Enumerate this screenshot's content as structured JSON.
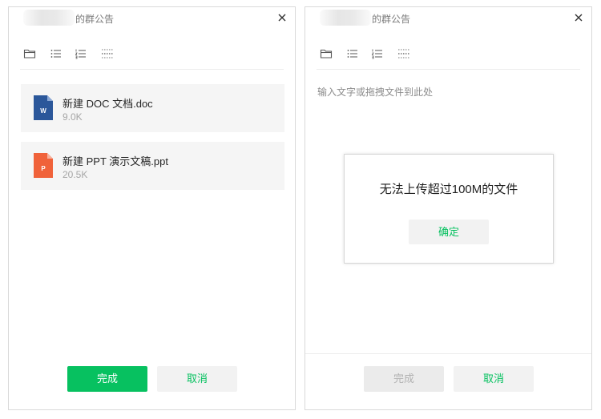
{
  "left_panel": {
    "title_suffix": "的群公告",
    "files": [
      {
        "name": "新建 DOC 文档.doc",
        "size": "9.0K",
        "icon": "word-doc-icon",
        "icon_color": "#2b579a",
        "icon_letter": "W"
      },
      {
        "name": "新建 PPT 演示文稿.ppt",
        "size": "20.5K",
        "icon": "powerpoint-icon",
        "icon_color": "#f0623a",
        "icon_letter": "P"
      }
    ],
    "buttons": {
      "done": "完成",
      "cancel": "取消"
    }
  },
  "right_panel": {
    "title_suffix": "的群公告",
    "placeholder": "输入文字或拖拽文件到此处",
    "buttons": {
      "done": "完成",
      "cancel": "取消"
    }
  },
  "dialog": {
    "message": "无法上传超过100M的文件",
    "ok": "确定"
  },
  "toolbar_icons": [
    "folder-icon",
    "bulleted-list-icon",
    "numbered-list-icon",
    "divider-icon"
  ],
  "colors": {
    "accent": "#07c160",
    "disabled_bg": "#ebebeb",
    "disabled_text": "#b2b2b2"
  }
}
